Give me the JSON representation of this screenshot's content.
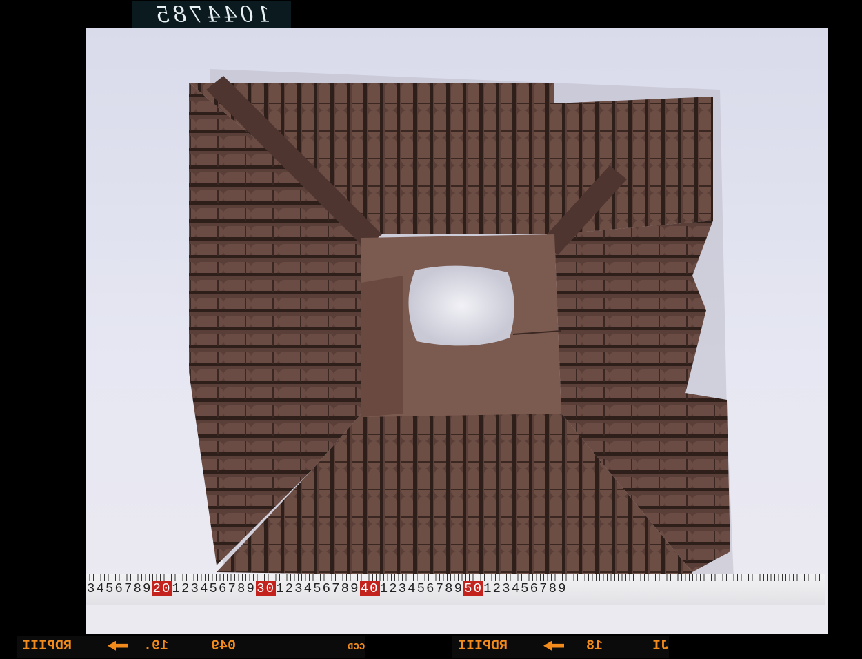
{
  "handwritten_label": "1044785",
  "ruler": {
    "segments": [
      {
        "text": "3456789",
        "red": false
      },
      {
        "text": "20",
        "red": true
      },
      {
        "text": "123456789",
        "red": false
      },
      {
        "text": "30",
        "red": true
      },
      {
        "text": "123456789",
        "red": false
      },
      {
        "text": "40",
        "red": true
      },
      {
        "text": "123456789",
        "red": false
      },
      {
        "text": "50",
        "red": true
      },
      {
        "text": "123456789",
        "red": false
      }
    ]
  },
  "film_edge": {
    "left_brand": "RDPIII",
    "left_frame": "19.",
    "left_code": "049",
    "center_text": "CBECCD",
    "right_brand": "RDPIII",
    "right_frame": "18",
    "right_maker": "FUJI"
  },
  "colors": {
    "backdrop": "#e4e5f0",
    "clay": "#5a3f38",
    "clay_dark": "#3b2823",
    "ruler_red": "#c4221c",
    "film_orange": "#f28a1c"
  }
}
